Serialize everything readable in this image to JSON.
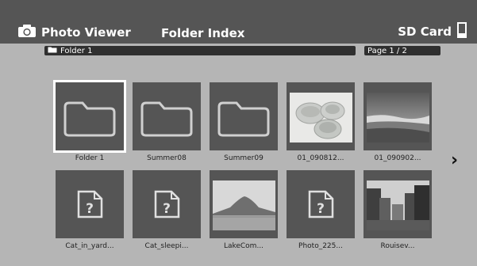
{
  "header": {
    "app_title": "Photo Viewer",
    "screen_title": "Folder Index",
    "storage_label": "SD Card"
  },
  "path": {
    "folder": "Folder 1"
  },
  "pagination": {
    "label": "Page 1 / 2"
  },
  "items": [
    {
      "label": "Folder 1",
      "type": "folder",
      "selected": true
    },
    {
      "label": "Summer08",
      "type": "folder"
    },
    {
      "label": "Summer09",
      "type": "folder"
    },
    {
      "label": "01_090812...",
      "type": "photo",
      "thumbnail": "bowls-photo"
    },
    {
      "label": "01_090902...",
      "type": "photo",
      "thumbnail": "landscape-photo"
    },
    {
      "label": "Cat_in_yard...",
      "type": "unknown-file"
    },
    {
      "label": "Cat_sleepi...",
      "type": "unknown-file"
    },
    {
      "label": "LakeCom...",
      "type": "photo",
      "thumbnail": "mountain-lake-photo"
    },
    {
      "label": "Photo_225...",
      "type": "unknown-file"
    },
    {
      "label": "Rouisev...",
      "type": "photo",
      "thumbnail": "city-street-photo"
    }
  ],
  "navigation": {
    "next_page_glyph": "›"
  },
  "colors": {
    "background": "#b5b5b5",
    "titlebar": "#555555",
    "tile": "#555555",
    "selection": "#ffffff"
  }
}
